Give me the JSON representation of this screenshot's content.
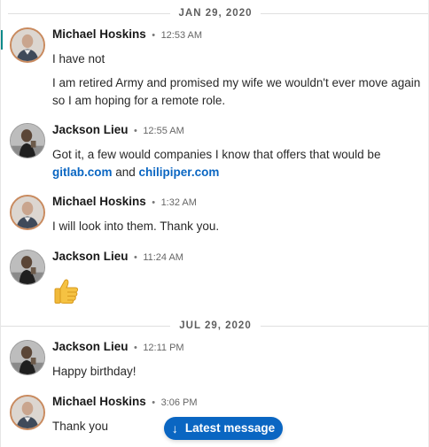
{
  "dividers": {
    "first": "JAN 29, 2020",
    "second": "JUL 29, 2020"
  },
  "messages": [
    {
      "sender": "Michael Hoskins",
      "separator": "•",
      "time": "12:53 AM",
      "lines": [
        "I have not",
        "I am retired Army and promised my wife we wouldn't ever move again so I am hoping for a remote role."
      ]
    },
    {
      "sender": "Jackson Lieu",
      "separator": "•",
      "time": "12:55 AM",
      "text_before": "Got it, a few would companies I know that offers that would be ",
      "link1": "gitlab.com",
      "text_and": " and ",
      "link2": "chilipiper.com"
    },
    {
      "sender": "Michael Hoskins",
      "separator": "•",
      "time": "1:32 AM",
      "text": "I will look into them. Thank you."
    },
    {
      "sender": "Jackson Lieu",
      "separator": "•",
      "time": "11:24 AM",
      "emoji": "thumbs-up"
    },
    {
      "sender": "Jackson Lieu",
      "separator": "•",
      "time": "12:11 PM",
      "text": "Happy birthday!"
    },
    {
      "sender": "Michael Hoskins",
      "separator": "•",
      "time": "3:06 PM",
      "text": "Thank you"
    }
  ],
  "latest_button": {
    "label": "Latest message",
    "icon": "arrow-down-icon"
  },
  "colors": {
    "link": "#0a66c2",
    "button_bg": "#0a66c2",
    "accent_edge": "#0a8a8a"
  }
}
